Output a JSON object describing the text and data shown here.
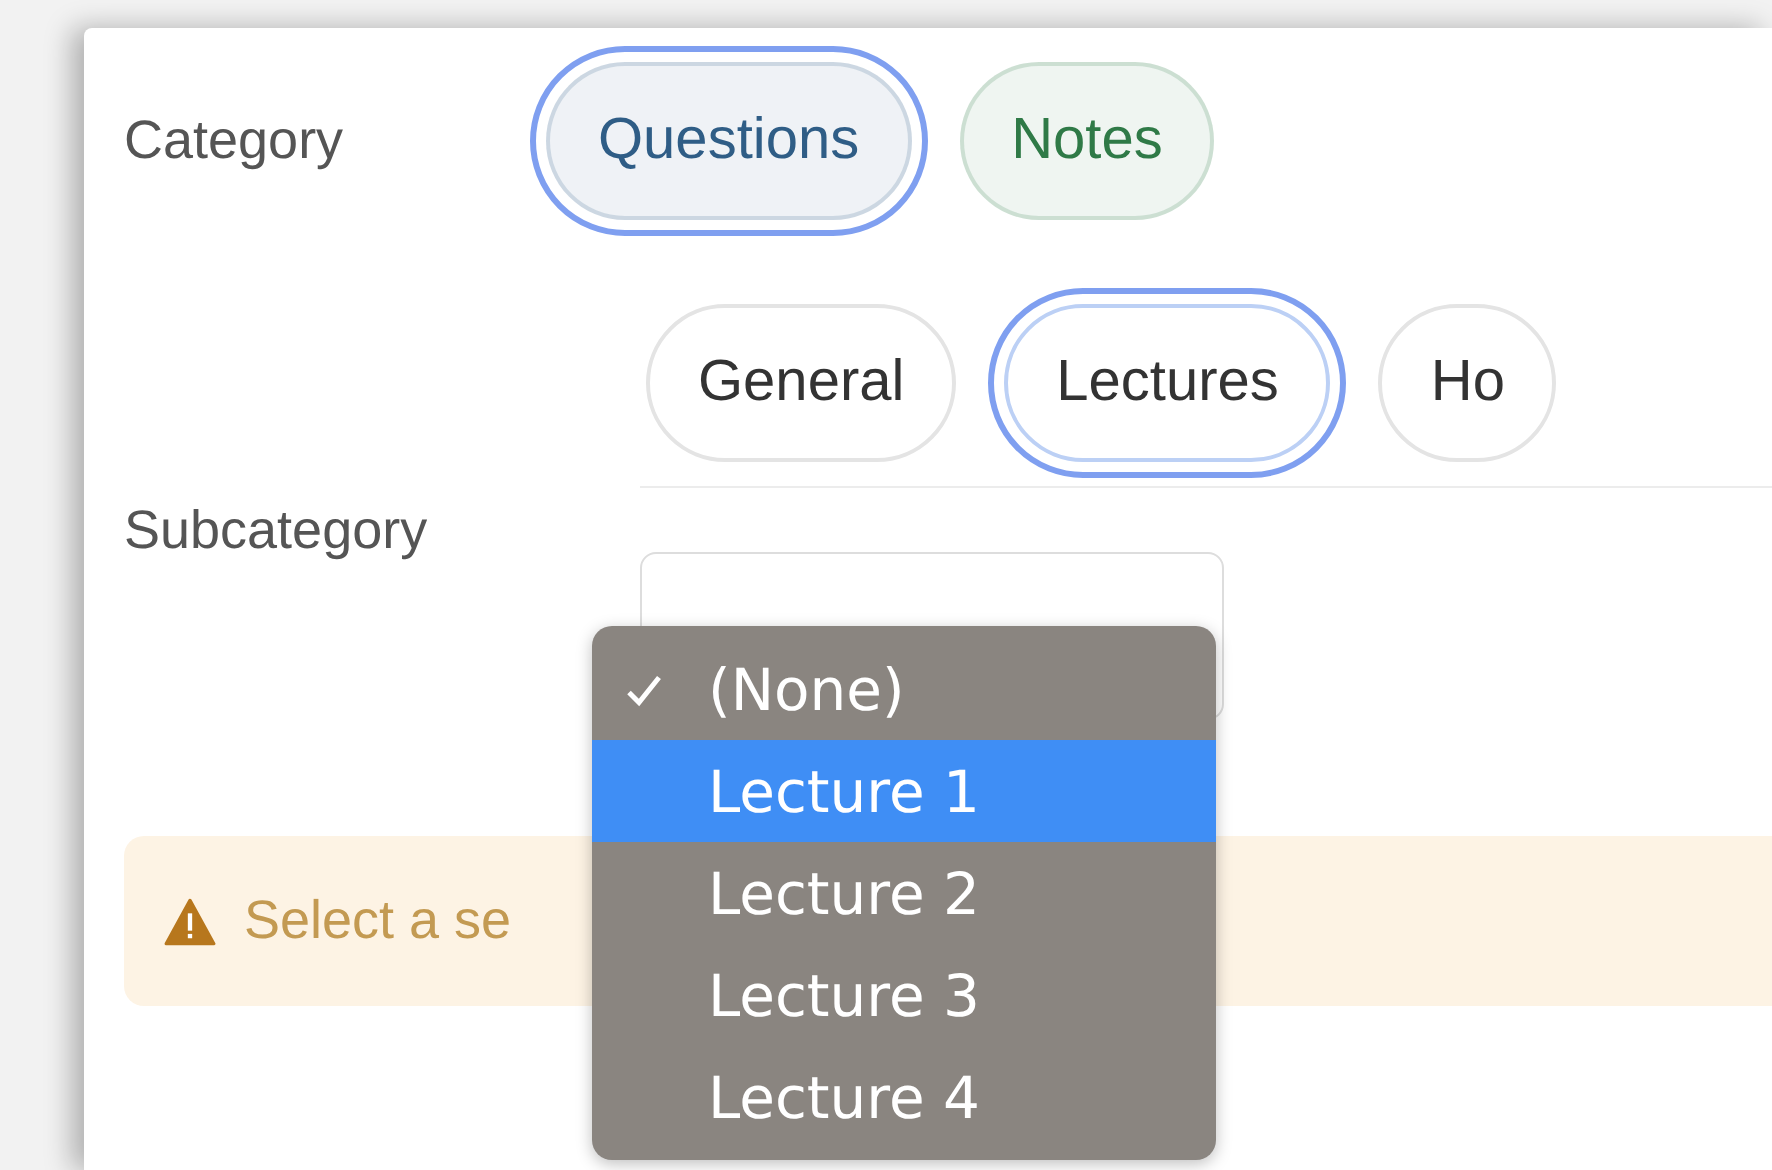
{
  "category": {
    "label": "Category",
    "options": [
      {
        "label": "Questions",
        "selected": true,
        "color": "#2f5d86"
      },
      {
        "label": "Notes",
        "selected": false,
        "color": "#2f7a47"
      }
    ]
  },
  "subcategory": {
    "label": "Subcategory",
    "options": [
      {
        "label": "General",
        "selected": false
      },
      {
        "label": "Lectures",
        "selected": true
      },
      {
        "label": "Ho",
        "selected": false
      }
    ]
  },
  "dropdown": {
    "items": [
      {
        "label": "(None)",
        "checked": true,
        "highlighted": false
      },
      {
        "label": "Lecture 1",
        "checked": false,
        "highlighted": true
      },
      {
        "label": "Lecture 2",
        "checked": false,
        "highlighted": false
      },
      {
        "label": "Lecture 3",
        "checked": false,
        "highlighted": false
      },
      {
        "label": "Lecture 4",
        "checked": false,
        "highlighted": false
      }
    ]
  },
  "warning": {
    "text": "Select a se"
  }
}
